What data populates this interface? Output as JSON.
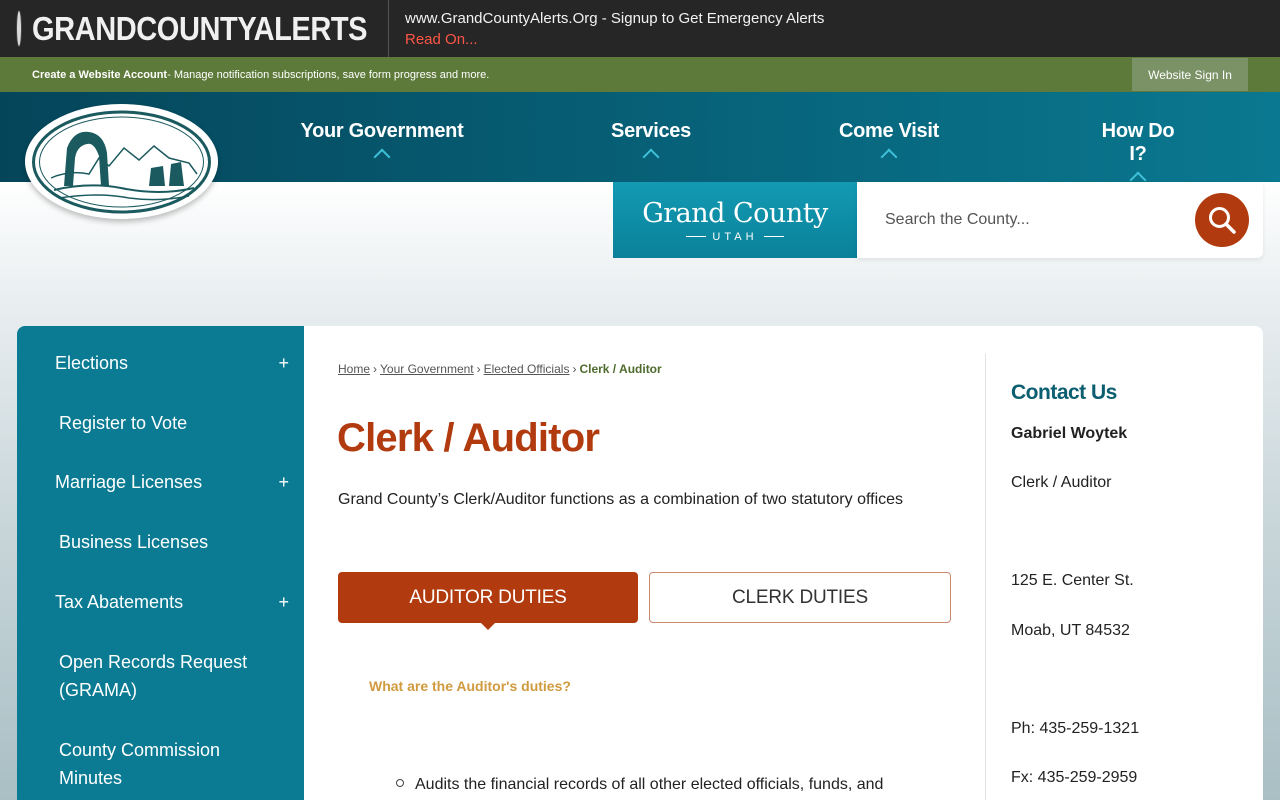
{
  "alert": {
    "brand": "GRANDCOUNTYALERTS",
    "message": "www.GrandCountyAlerts.Org - Signup to Get Emergency Alerts",
    "link": "Read On..."
  },
  "account": {
    "link_label": "Create a Website Account",
    "description": " - Manage notification subscriptions, save form progress and more.",
    "signin_label": "Website Sign In"
  },
  "nav": {
    "items": [
      {
        "label": "Your Government"
      },
      {
        "label": "Services"
      },
      {
        "label": "Come Visit"
      },
      {
        "label": "How Do I?"
      }
    ]
  },
  "badge": {
    "name": "Grand County",
    "state": "UTAH"
  },
  "search": {
    "placeholder": "Search the County..."
  },
  "sidebar": {
    "items": [
      {
        "label": "Elections",
        "expand": "+"
      },
      {
        "label": "Register to Vote"
      },
      {
        "label": "Marriage Licenses",
        "expand": "+"
      },
      {
        "label": "Business Licenses"
      },
      {
        "label": "Tax Abatements",
        "expand": "+"
      },
      {
        "label": "Open Records Request (GRAMA)"
      },
      {
        "label": "County Commission Minutes"
      }
    ]
  },
  "breadcrumb": {
    "items": [
      "Home",
      "Your Government",
      "Elected Officials"
    ],
    "separator": "›",
    "current": "Clerk / Auditor"
  },
  "main": {
    "title": "Clerk / Auditor",
    "intro": "Grand County’s Clerk/Auditor functions as a combination of two statutory offices",
    "tabs": [
      {
        "label": "AUDITOR DUTIES"
      },
      {
        "label": "CLERK DUTIES"
      }
    ],
    "question": "What are the Auditor's duties?",
    "duties": [
      "Audits the financial records of all other elected officials, funds, and"
    ]
  },
  "contact": {
    "title": "Contact Us",
    "name": "Gabriel Woytek",
    "role": "Clerk / Auditor",
    "address1": "125 E. Center St.",
    "address2": "Moab, UT 84532",
    "phone": "Ph: 435-259-1321",
    "fax": "Fx: 435-259-2959"
  },
  "colors": {
    "accent": "#b13a0e",
    "nav": "#07657c",
    "sidebar": "#0b7b93",
    "account_bar": "#5e7a3a"
  }
}
